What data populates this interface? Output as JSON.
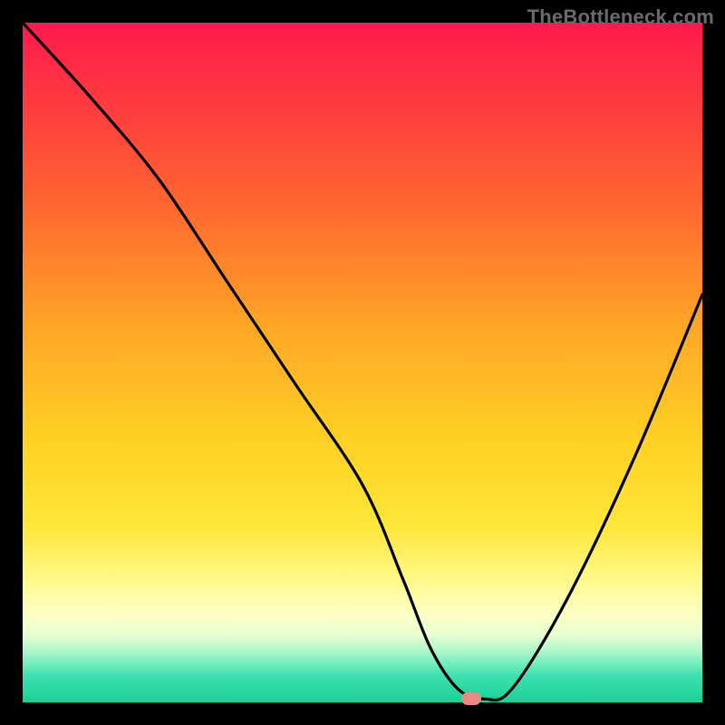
{
  "watermark": "TheBottleneck.com",
  "chart_data": {
    "type": "line",
    "title": "",
    "xlabel": "",
    "ylabel": "",
    "xlim": [
      0,
      100
    ],
    "ylim": [
      0,
      100
    ],
    "grid": false,
    "background": "gradient-red-to-green-vertical",
    "series": [
      {
        "name": "bottleneck-curve",
        "color": "#000000",
        "x": [
          0,
          10,
          20,
          30,
          40,
          50,
          56,
          60,
          64,
          68,
          72,
          80,
          90,
          100
        ],
        "y": [
          100,
          89,
          77,
          62,
          47,
          32,
          18,
          8,
          2,
          0.5,
          2,
          15,
          36,
          60
        ]
      }
    ],
    "marker": {
      "name": "optimal-point",
      "x": 66,
      "y": 0.5,
      "color": "#e98b82"
    }
  }
}
